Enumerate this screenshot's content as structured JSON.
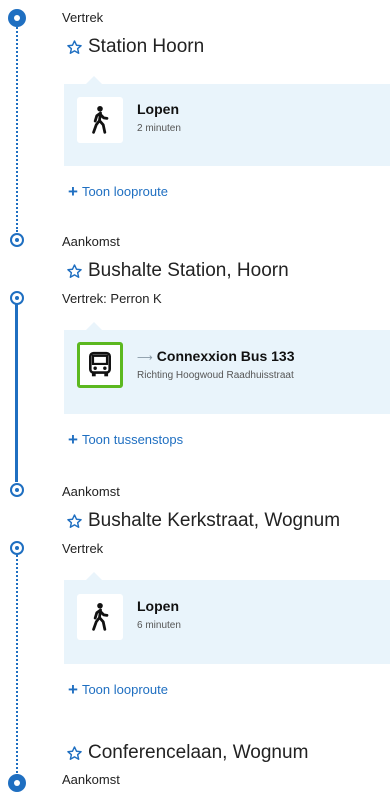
{
  "colors": {
    "accent": "#1f6fc1",
    "card_bg": "#e9f4fb",
    "bus_border": "#5cb81f"
  },
  "legs": {
    "stop1": {
      "label": "Vertrek",
      "name": "Station Hoorn"
    },
    "walk1": {
      "title": "Lopen",
      "duration": "2 minuten",
      "icon": "walking-person-icon"
    },
    "walk1_link": "Toon looproute",
    "stop2": {
      "arrival_label": "Aankomst",
      "name": "Bushalte Station, Hoorn",
      "departure_label": "Vertrek: Perron K"
    },
    "bus": {
      "arrow": "⟶",
      "title": "Connexxion Bus 133",
      "direction": "Richting Hoogwoud Raadhuisstraat",
      "icon": "bus-icon"
    },
    "bus_link": "Toon tussenstops",
    "stop3": {
      "arrival_label": "Aankomst",
      "name": "Bushalte Kerkstraat, Wognum",
      "departure_label": "Vertrek"
    },
    "walk2": {
      "title": "Lopen",
      "duration": "6 minuten",
      "icon": "walking-person-icon"
    },
    "walk2_link": "Toon looproute",
    "stop4": {
      "name": "Conferencelaan, Wognum",
      "arrival_label": "Aankomst"
    }
  }
}
